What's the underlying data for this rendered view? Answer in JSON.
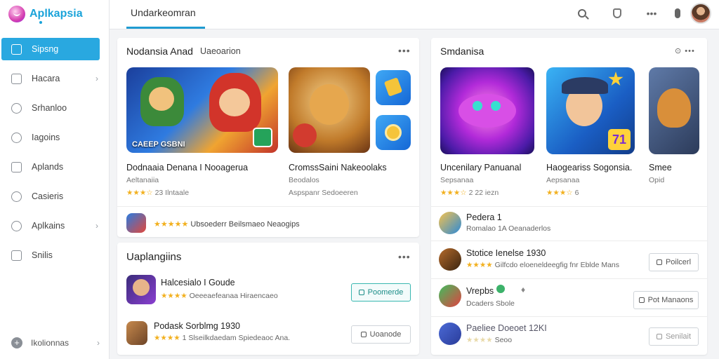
{
  "app": {
    "name": "Aplkapsia"
  },
  "sidebar": {
    "items": [
      {
        "label": "Sipsng",
        "icon": "home-icon",
        "active": true
      },
      {
        "label": "Hacara",
        "icon": "bag-icon",
        "chevron": true
      },
      {
        "label": "Srhanloo",
        "icon": "compass-icon"
      },
      {
        "label": "Iagoins",
        "icon": "badge-icon"
      },
      {
        "label": "Aplands",
        "icon": "grid-icon"
      },
      {
        "label": "Casieris",
        "icon": "clock-icon"
      },
      {
        "label": "Aplkains",
        "icon": "wrench-icon",
        "chevron": true
      },
      {
        "label": "Snilis",
        "icon": "chart-icon"
      }
    ],
    "bottom": {
      "label": "Ikolionnas",
      "icon": "plus-icon"
    }
  },
  "topbar": {
    "tab": "Undarkeomran",
    "icons": [
      "search-icon",
      "shield-icon",
      "more-icon",
      "mic-icon",
      "avatar"
    ]
  },
  "card1": {
    "title": "Nodansia Anad",
    "title_suffix": "Uaeoarion",
    "banner_text": "CAEEP GSBNI",
    "apps": [
      {
        "name": "Dodnaaia Denana I Nooagerua",
        "sub": "Aeltanaiia",
        "rating": "23 Ilntaale"
      },
      {
        "name": "CromssSaini Nakeoolaks",
        "sub": "Beodalos",
        "rating": "Aspspanr Sedoeeren"
      }
    ],
    "footer": {
      "text": "Ubsoederr Beilsmaeo Neaogips"
    }
  },
  "card2": {
    "title": "Smdanisa",
    "more": "⊙ •••",
    "apps": [
      {
        "name": "Uncenilary Panuanal",
        "sub": "Sepsanaa",
        "rating": "2 22 iezn",
        "badge": ""
      },
      {
        "name": "Haogeariss Sogonsia.",
        "sub": "Aepsanaa",
        "rating": "6",
        "badge": "71"
      },
      {
        "name": "Smee",
        "sub": "Opid",
        "rating": "",
        "badge": ""
      }
    ],
    "list": [
      {
        "title": "Pedera 1",
        "sub": "Romalao 1A Oeanaderlos",
        "button": ""
      },
      {
        "title": "Stotice Ienelse 1930",
        "sub": "Gilfcdo eloeneldeegfig fnr Eblde Mans",
        "button": "Poilcerl"
      },
      {
        "title": "Vrepbs",
        "sub": "Dcaders Sbole",
        "button": "Pot Manaons"
      },
      {
        "title": "Paeliee Doeoet 12KI",
        "sub": "Seoo",
        "button": "Senilait"
      }
    ]
  },
  "card3": {
    "title": "Uaplangiins",
    "items": [
      {
        "title": "Halcesialo I Goude",
        "sub": "Oeeeaefeanaa Hiraencaeo",
        "button": "Poomerde"
      },
      {
        "title": "Podask Sorblmg 1930",
        "sub": "1 Slseilkdaedam Spiedeaoc Ana.",
        "button": "Uoanode"
      }
    ]
  },
  "colors": {
    "accent": "#29a8e0",
    "star": "#f2b01e",
    "primary_button": "#38b7b0"
  }
}
